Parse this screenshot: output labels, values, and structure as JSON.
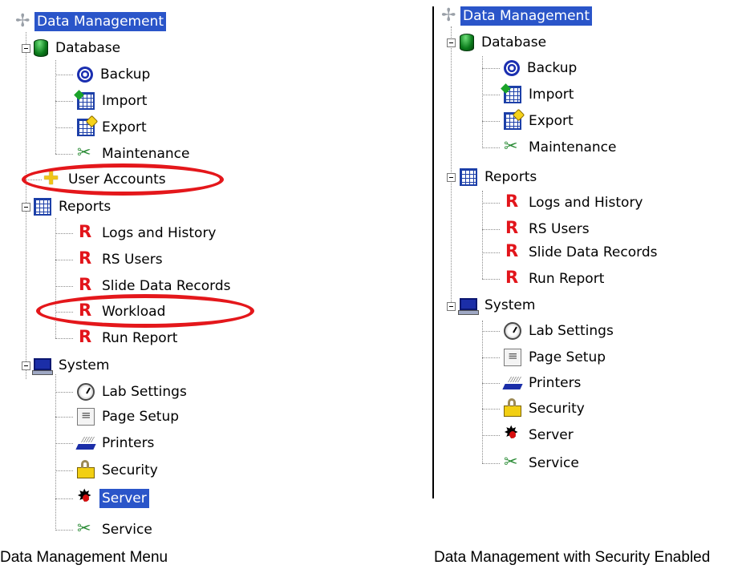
{
  "left": {
    "root": "Data Management",
    "database": "Database",
    "backup": "Backup",
    "import": "Import",
    "export": "Export",
    "maintenance": "Maintenance",
    "user_accounts": "User Accounts",
    "reports": "Reports",
    "logs_history": "Logs and History",
    "rs_users": "RS Users",
    "slide_data_records": "Slide Data Records",
    "workload": "Workload",
    "run_report": "Run Report",
    "system": "System",
    "lab_settings": "Lab Settings",
    "page_setup": "Page Setup",
    "printers": "Printers",
    "security": "Security",
    "server": "Server",
    "service": "Service"
  },
  "right": {
    "root": "Data Management",
    "database": "Database",
    "backup": "Backup",
    "import": "Import",
    "export": "Export",
    "maintenance": "Maintenance",
    "reports": "Reports",
    "logs_history": "Logs and History",
    "rs_users": "RS Users",
    "slide_data_records": "Slide Data Records",
    "run_report": "Run Report",
    "system": "System",
    "lab_settings": "Lab Settings",
    "page_setup": "Page Setup",
    "printers": "Printers",
    "security": "Security",
    "server": "Server",
    "service": "Service"
  },
  "captions": {
    "left": "Data Management Menu",
    "right": "Data Management with Security Enabled"
  },
  "colors": {
    "selection": "#2a55c9",
    "highlight_ellipse": "#e4171b",
    "report_icon": "#e2151b"
  },
  "icons": {
    "root": "tree-root-icon",
    "database": "database-icon",
    "backup": "backup-disc-icon",
    "import": "import-table-icon",
    "export": "export-table-icon",
    "maintenance": "tools-icon",
    "user_accounts": "user-accounts-icon",
    "reports": "reports-table-icon",
    "report_item": "report-r-icon",
    "system": "computer-icon",
    "lab_settings": "clock-icon",
    "page_setup": "page-icon",
    "printers": "printer-icon",
    "security": "lock-icon",
    "server": "bug-icon",
    "service": "tools-icon"
  }
}
